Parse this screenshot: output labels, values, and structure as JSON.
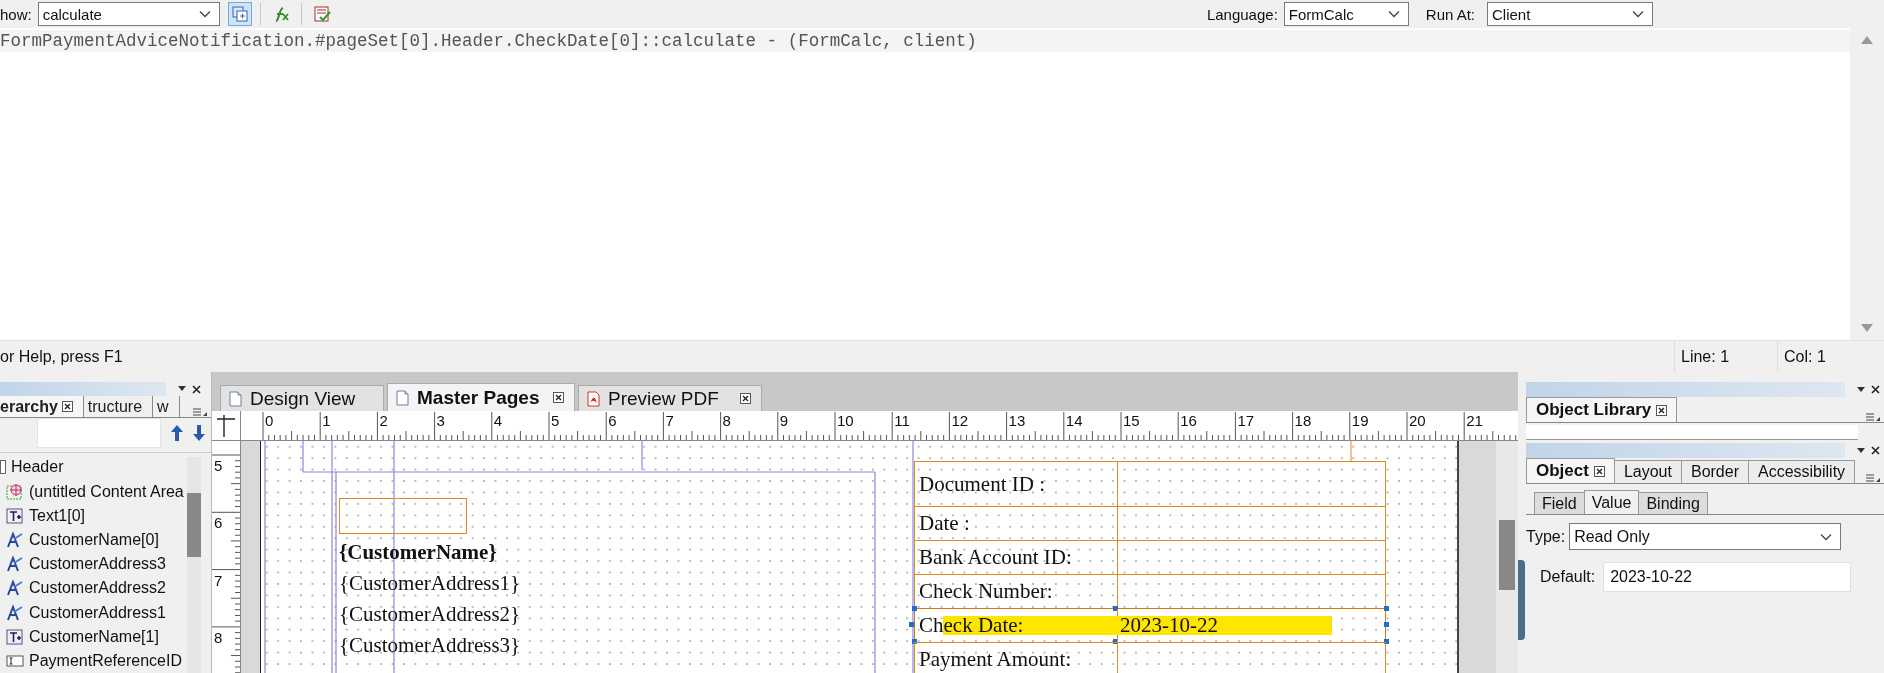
{
  "toolbar": {
    "show_label": "how:",
    "event": "calculate",
    "tools": [
      {
        "kind": "objects",
        "selected": true
      },
      {
        "kind": "functions",
        "selected": false
      },
      {
        "kind": "check",
        "selected": false
      }
    ],
    "language_label": "Language:",
    "language": "FormCalc",
    "run_at_label": "Run At:",
    "run_at": "Client"
  },
  "editor": {
    "lines": [
      "FormPaymentAdviceNotification.#pageSet[0].Header.CheckDate[0]::calculate - (FormCalc, client)"
    ]
  },
  "status_bar": {
    "message": "or Help, press F1",
    "line": "Line: 1",
    "col": "Col: 1"
  },
  "hierarchy": {
    "tabs": [
      {
        "label": "erarchy",
        "selected": true
      },
      {
        "label": "tructure",
        "selected": false
      },
      {
        "label": "w",
        "selected": false
      }
    ],
    "tree": [
      {
        "label": "Header",
        "kind": "subform",
        "children": [
          {
            "label": "(untitled Content Area",
            "kind": "content-area"
          },
          {
            "label": "Text1[0]",
            "kind": "text"
          },
          {
            "label": "CustomerName[0]",
            "kind": "field"
          },
          {
            "label": "CustomerAddress3",
            "kind": "field"
          },
          {
            "label": "CustomerAddress2",
            "kind": "field"
          },
          {
            "label": "CustomerAddress1",
            "kind": "field"
          },
          {
            "label": "CustomerName[1]",
            "kind": "text"
          },
          {
            "label": "PaymentReferenceID",
            "kind": "textfield"
          }
        ]
      }
    ]
  },
  "design": {
    "tabs": [
      {
        "label": "Design View",
        "kind": "page",
        "selected": false,
        "closable": false
      },
      {
        "label": "Master Pages",
        "kind": "page",
        "selected": true,
        "closable": true
      },
      {
        "label": "Preview PDF",
        "kind": "pdf",
        "selected": false,
        "closable": true
      }
    ],
    "ruler_h": [
      "0",
      "1",
      "2",
      "3",
      "4",
      "5",
      "6",
      "7",
      "8",
      "9",
      "10",
      "11",
      "12",
      "13",
      "14",
      "15",
      "16",
      "17",
      "18",
      "19",
      "20",
      "21"
    ],
    "ruler_v": [
      "5",
      "6",
      "7",
      "8"
    ],
    "address_block": {
      "name": "{CustomerName}",
      "lines": [
        "{CustomerAddress1}",
        "{CustomerAddress2}",
        "{CustomerAddress3}"
      ]
    },
    "fields": [
      {
        "label": "Document ID :",
        "selected": false
      },
      {
        "label": "Date :",
        "selected": false
      },
      {
        "label": "Bank Account ID:",
        "selected": false
      },
      {
        "label": "Check Number:",
        "selected": false
      },
      {
        "label": "Check Date:",
        "value": "2023-10-22",
        "selected": true
      },
      {
        "label": "Payment Amount:",
        "selected": false
      }
    ]
  },
  "object_library": {
    "title": "Object Library"
  },
  "object_panel": {
    "tabs": [
      {
        "label": "Object",
        "selected": true
      },
      {
        "label": "Layout",
        "selected": false
      },
      {
        "label": "Border",
        "selected": false
      },
      {
        "label": "Accessibility",
        "selected": false
      }
    ],
    "subtabs": [
      {
        "label": "Field",
        "selected": false
      },
      {
        "label": "Value",
        "selected": true
      },
      {
        "label": "Binding",
        "selected": false
      }
    ],
    "type_label": "Type:",
    "type": "Read Only",
    "default_label": "Default:",
    "default": "2023-10-22"
  }
}
